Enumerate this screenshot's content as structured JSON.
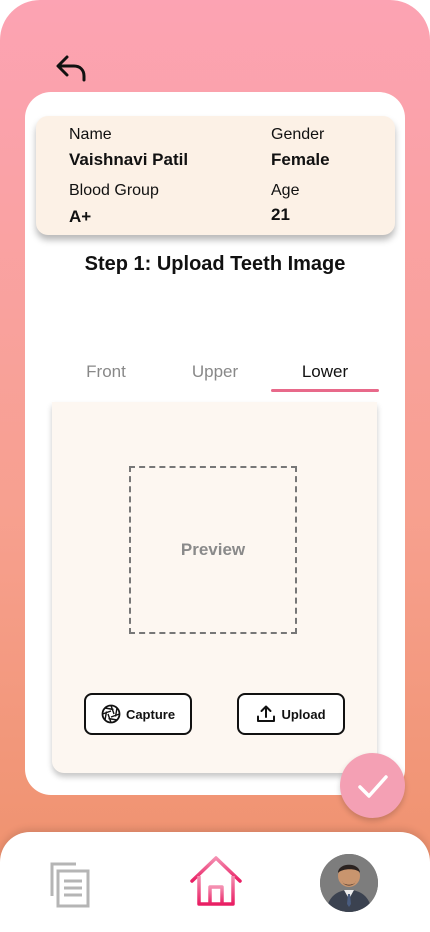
{
  "header": {
    "back_icon": "back-arrow-icon"
  },
  "patient": {
    "name_label": "Name",
    "name_value": "Vaishnavi Patil",
    "gender_label": "Gender",
    "gender_value": "Female",
    "blood_group_label": "Blood Group",
    "blood_group_value": "A+",
    "age_label": "Age",
    "age_value": "21"
  },
  "step_title": "Step 1: Upload Teeth Image",
  "tabs": [
    {
      "label": "Front",
      "active": false
    },
    {
      "label": "Upper",
      "active": false
    },
    {
      "label": "Lower",
      "active": true
    }
  ],
  "panel": {
    "preview_text": "Preview",
    "capture_label": "Capture",
    "upload_label": "Upload"
  },
  "nav": {
    "items": [
      "documents-icon",
      "home-icon",
      "profile-avatar"
    ],
    "active": "home-icon"
  },
  "colors": {
    "accent": "#e8698a",
    "home_active": "#e91e63",
    "card_bg": "#fcf1e6",
    "confirm_bg": "#f4a0b4"
  }
}
